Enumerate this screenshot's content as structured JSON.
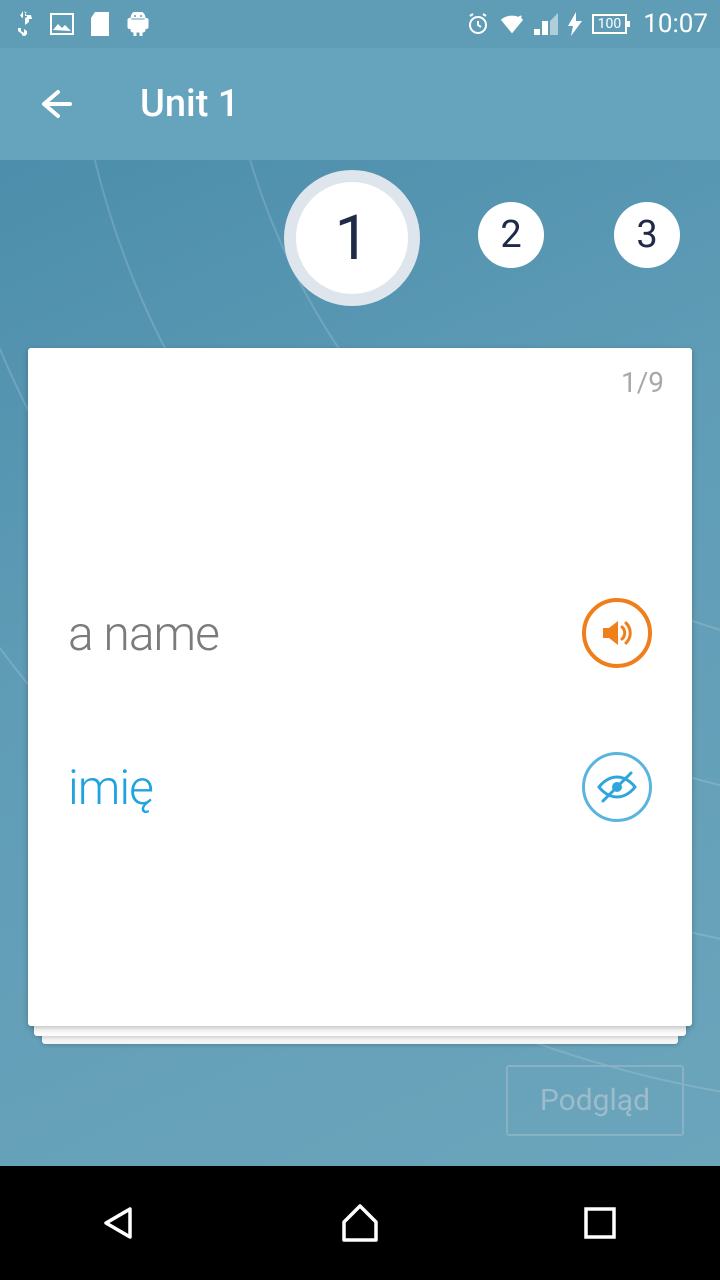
{
  "status": {
    "battery": "100",
    "time": "10:07"
  },
  "appbar": {
    "title": "Unit 1"
  },
  "steps": {
    "one": "1",
    "two": "2",
    "three": "3"
  },
  "card": {
    "counter": "1/9",
    "word": "a name",
    "translation": "imię"
  },
  "preview": {
    "label": "Podgląd"
  }
}
